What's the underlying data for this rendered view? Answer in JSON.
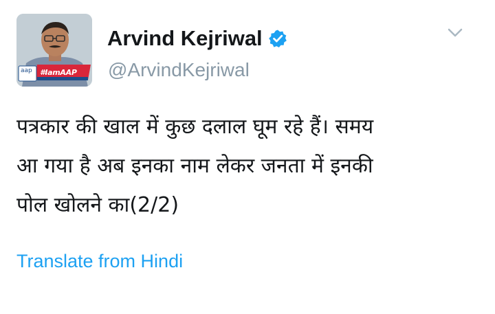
{
  "author": {
    "display_name": "Arvind Kejriwal",
    "handle": "@ArvindKejriwal",
    "verified": true,
    "avatar_badge_text": "#IamAAP",
    "avatar_logo_text": "aap"
  },
  "tweet": {
    "lines": [
      "पत्रकार की खाल में कुछ दलाल घूम रहे हैं। समय",
      "आ गया है अब इनका नाम लेकर जनता में इनकी",
      "पोल खोलने का(2/2)"
    ]
  },
  "actions": {
    "translate_label": "Translate from Hindi",
    "menu_icon": "chevron-down-icon"
  },
  "colors": {
    "name": "#14171a",
    "handle": "#8899a6",
    "link": "#1da1f2",
    "verified_badge": "#1da1f2",
    "caret": "#aab8c2"
  }
}
